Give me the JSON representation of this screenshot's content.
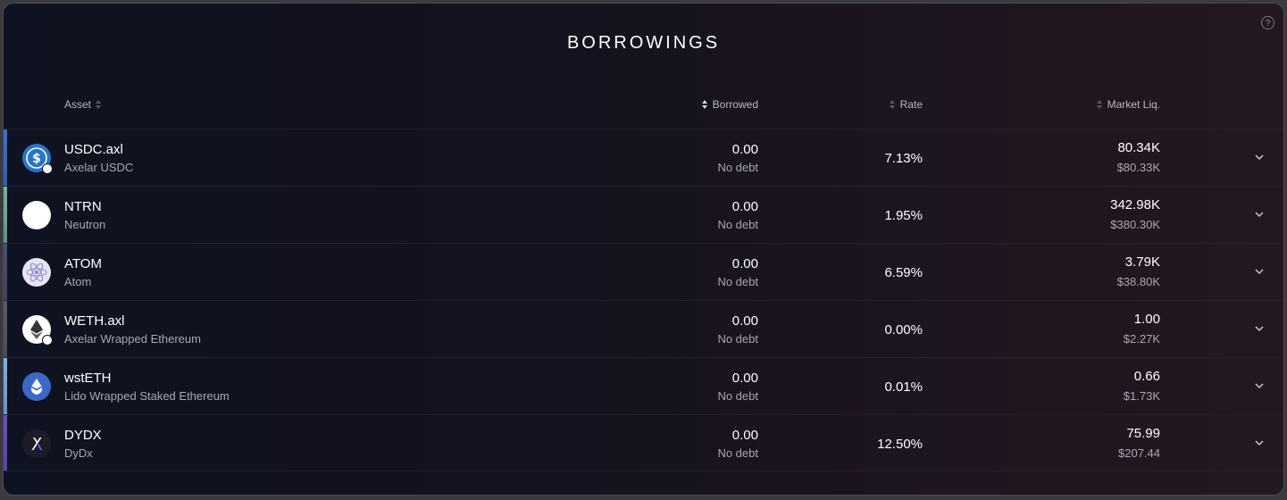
{
  "title": "BORROWINGS",
  "help_icon": "?",
  "columns": {
    "asset": "Asset",
    "borrowed": "Borrowed",
    "rate": "Rate",
    "market_liq": "Market Liq."
  },
  "rows": [
    {
      "symbol": "USDC.axl",
      "name": "Axelar USDC",
      "borrowed": "0.00",
      "borrowed_sub": "No debt",
      "rate": "7.13%",
      "liq": "80.34K",
      "liq_usd": "$80.33K",
      "strip_color": "#3b6fd8",
      "icon": "usdc-icon"
    },
    {
      "symbol": "NTRN",
      "name": "Neutron",
      "borrowed": "0.00",
      "borrowed_sub": "No debt",
      "rate": "1.95%",
      "liq": "342.98K",
      "liq_usd": "$380.30K",
      "strip_color": "#6fb59a",
      "icon": "neutron-icon"
    },
    {
      "symbol": "ATOM",
      "name": "Atom",
      "borrowed": "0.00",
      "borrowed_sub": "No debt",
      "rate": "6.59%",
      "liq": "3.79K",
      "liq_usd": "$38.80K",
      "strip_color": "#4a4f6e",
      "icon": "atom-icon"
    },
    {
      "symbol": "WETH.axl",
      "name": "Axelar Wrapped Ethereum",
      "borrowed": "0.00",
      "borrowed_sub": "No debt",
      "rate": "0.00%",
      "liq": "1.00",
      "liq_usd": "$2.27K",
      "strip_color": "#5a5a62",
      "icon": "ethereum-icon"
    },
    {
      "symbol": "wstETH",
      "name": "Lido Wrapped Staked Ethereum",
      "borrowed": "0.00",
      "borrowed_sub": "No debt",
      "rate": "0.01%",
      "liq": "0.66",
      "liq_usd": "$1.73K",
      "strip_color": "#7ab0f0",
      "icon": "lido-icon"
    },
    {
      "symbol": "DYDX",
      "name": "DyDx",
      "borrowed": "0.00",
      "borrowed_sub": "No debt",
      "rate": "12.50%",
      "liq": "75.99",
      "liq_usd": "$207.44",
      "strip_color": "#6a4fc8",
      "icon": "dydx-icon"
    }
  ]
}
